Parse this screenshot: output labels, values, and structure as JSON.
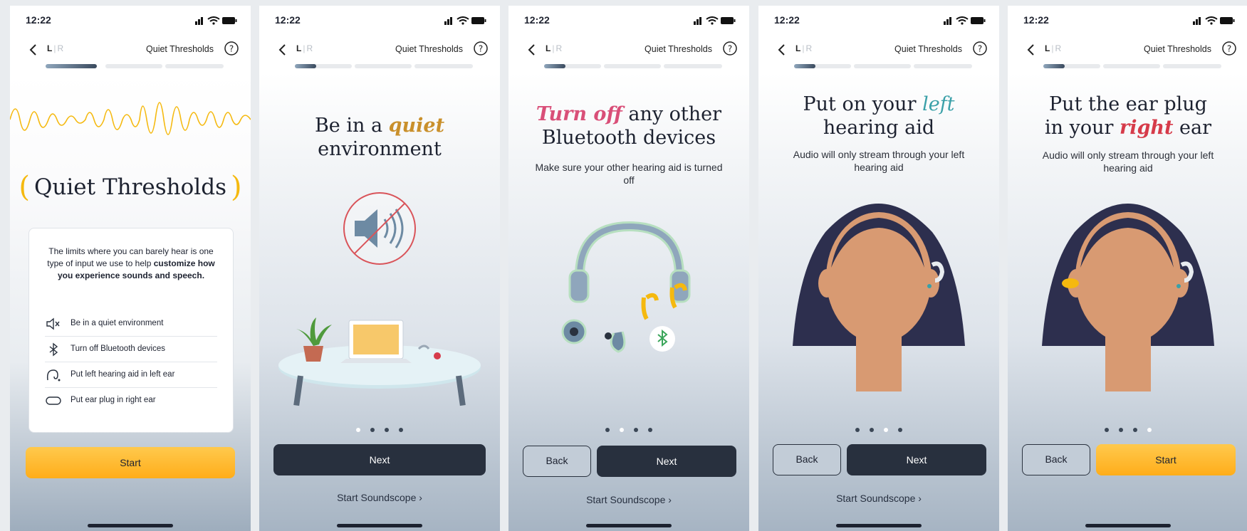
{
  "colors": {
    "accent_orange": "#f5b90f",
    "quiet_gold": "#c9902b",
    "turn_off_pink": "#d94f78",
    "left_teal": "#3aa0a8",
    "right_red": "#d63b4a",
    "dark_button": "#28303e"
  },
  "status": {
    "time": "12:22"
  },
  "nav": {
    "back_icon": "chevron-left-icon",
    "left_label": "L",
    "right_label": "R",
    "title": "Quiet Thresholds",
    "help_icon": "help-circle-icon"
  },
  "screen1": {
    "title": "Quiet Thresholds",
    "intro_plain": "The limits where you can barely hear is one type of input we use to help",
    "intro_bold": "customize how you experience sounds and speech.",
    "checklist": [
      {
        "icon": "speaker-muted-icon",
        "label": "Be in a quiet environment"
      },
      {
        "icon": "bluetooth-icon",
        "label": "Turn off Bluetooth devices"
      },
      {
        "icon": "hearing-aid-icon",
        "label": "Put left hearing aid in left ear"
      },
      {
        "icon": "ear-plug-icon",
        "label": "Put ear plug in right ear"
      }
    ],
    "start_label": "Start"
  },
  "screen2": {
    "title_before": "Be in a",
    "title_em": "quiet",
    "title_after": "environment",
    "next_label": "Next",
    "soundscope_label": "Start Soundscope"
  },
  "screen3": {
    "title_em": "Turn off",
    "title_after": "any other",
    "title_line2": "Bluetooth devices",
    "subtitle": "Make sure your other hearing aid is turned off",
    "back_label": "Back",
    "next_label": "Next",
    "soundscope_label": "Start Soundscope"
  },
  "screen4": {
    "title_before": "Put on your",
    "title_em": "left",
    "title_line2": "hearing aid",
    "subtitle": "Audio will only stream through your left hearing aid",
    "back_label": "Back",
    "next_label": "Next",
    "soundscope_label": "Start Soundscope"
  },
  "screen5": {
    "title_line1": "Put the ear plug",
    "title_before": "in your",
    "title_em": "right",
    "title_after": "ear",
    "subtitle": "Audio will only stream through your left hearing aid",
    "back_label": "Back",
    "start_label": "Start"
  },
  "pager": {
    "total": 4,
    "active_screen2": 1,
    "active_screen3": 2,
    "active_screen4": 3,
    "active_screen5": 4
  },
  "onboarding_progress": {
    "segments": 3,
    "current_segment": 1,
    "current_fraction": 0.4
  }
}
